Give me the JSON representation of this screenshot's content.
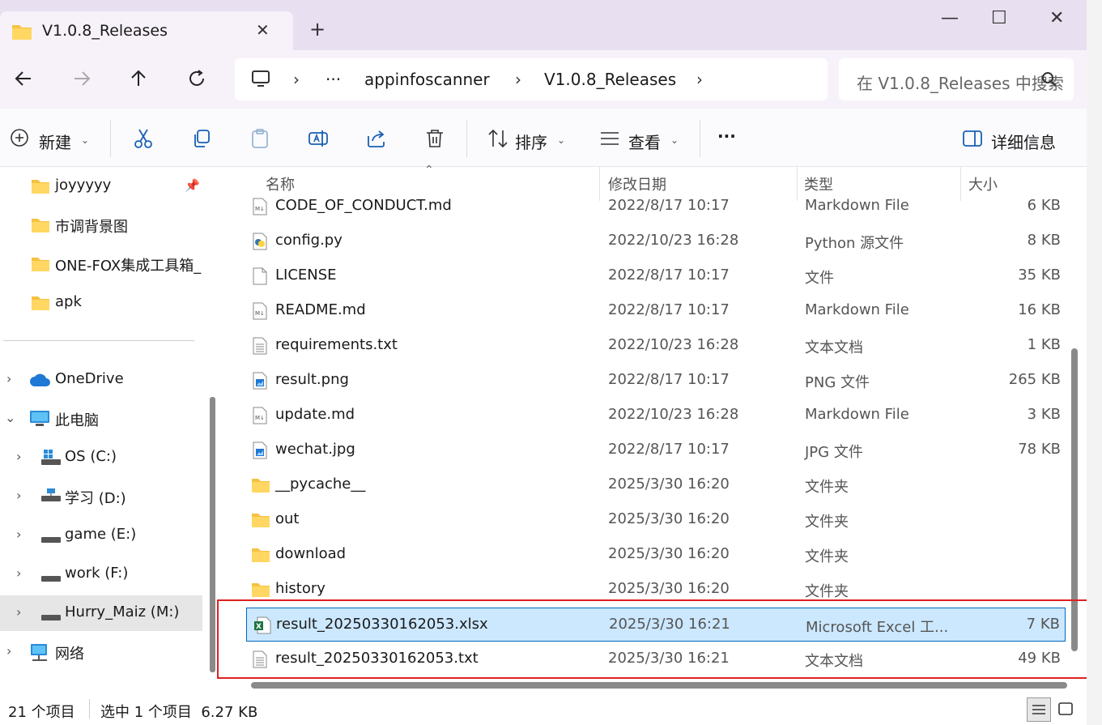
{
  "window": {
    "tab_title": "V1.0.8_Releases",
    "tab_close": "✕",
    "new_tab": "+",
    "minimize": "—",
    "maximize": "☐",
    "close": "✕"
  },
  "nav": {
    "breadcrumbs": [
      "appinfoscanner",
      "V1.0.8_Releases"
    ],
    "more": "···",
    "search_placeholder": "在 V1.0.8_Releases 中搜索"
  },
  "toolbar": {
    "new_label": "新建",
    "sort_label": "排序",
    "view_label": "查看",
    "more": "···",
    "details_label": "详细信息"
  },
  "sidebar": {
    "pinned": [
      {
        "label": "joyyyyy",
        "icon": "folder-icon",
        "pinned": true
      },
      {
        "label": "市调背景图",
        "icon": "folder-icon"
      },
      {
        "label": "ONE-FOX集成工具箱_",
        "icon": "folder-icon"
      },
      {
        "label": "apk",
        "icon": "folder-icon"
      }
    ],
    "tree": [
      {
        "label": "OneDrive",
        "icon": "cloud-icon",
        "expander": "›"
      },
      {
        "label": "此电脑",
        "icon": "computer-icon",
        "expander": "⌄"
      },
      {
        "label": "OS (C:)",
        "icon": "os-drive-icon",
        "expander": "›"
      },
      {
        "label": "学习 (D:)",
        "icon": "network-drive-icon",
        "expander": "›"
      },
      {
        "label": "game (E:)",
        "icon": "drive-icon",
        "expander": "›"
      },
      {
        "label": "work (F:)",
        "icon": "drive-icon",
        "expander": "›"
      },
      {
        "label": "Hurry_Maiz (M:)",
        "icon": "drive-icon",
        "expander": "›",
        "active": true
      },
      {
        "label": "网络",
        "icon": "network-icon",
        "expander": "›"
      }
    ]
  },
  "columns": {
    "name": "名称",
    "date": "修改日期",
    "type": "类型",
    "size": "大小"
  },
  "files": [
    {
      "name": "CODE_OF_CONDUCT.md",
      "date": "2022/8/17 10:17",
      "type": "Markdown File",
      "size": "6 KB",
      "icon": "markdown-icon"
    },
    {
      "name": "config.py",
      "date": "2022/10/23 16:28",
      "type": "Python 源文件",
      "size": "8 KB",
      "icon": "python-icon"
    },
    {
      "name": "LICENSE",
      "date": "2022/8/17 10:17",
      "type": "文件",
      "size": "35 KB",
      "icon": "file-icon"
    },
    {
      "name": "README.md",
      "date": "2022/8/17 10:17",
      "type": "Markdown File",
      "size": "16 KB",
      "icon": "markdown-icon"
    },
    {
      "name": "requirements.txt",
      "date": "2022/10/23 16:28",
      "type": "文本文档",
      "size": "1 KB",
      "icon": "text-file-icon"
    },
    {
      "name": "result.png",
      "date": "2022/8/17 10:17",
      "type": "PNG 文件",
      "size": "265 KB",
      "icon": "image-icon"
    },
    {
      "name": "update.md",
      "date": "2022/10/23 16:28",
      "type": "Markdown File",
      "size": "3 KB",
      "icon": "markdown-icon"
    },
    {
      "name": "wechat.jpg",
      "date": "2022/8/17 10:17",
      "type": "JPG 文件",
      "size": "78 KB",
      "icon": "image-icon"
    },
    {
      "name": "__pycache__",
      "date": "2025/3/30 16:20",
      "type": "文件夹",
      "size": "",
      "icon": "folder-icon"
    },
    {
      "name": "out",
      "date": "2025/3/30 16:20",
      "type": "文件夹",
      "size": "",
      "icon": "folder-icon"
    },
    {
      "name": "download",
      "date": "2025/3/30 16:20",
      "type": "文件夹",
      "size": "",
      "icon": "folder-icon"
    },
    {
      "name": "history",
      "date": "2025/3/30 16:20",
      "type": "文件夹",
      "size": "",
      "icon": "folder-icon"
    },
    {
      "name": "result_20250330162053.xlsx",
      "date": "2025/3/30 16:21",
      "type": "Microsoft Excel 工...",
      "size": "7 KB",
      "icon": "excel-icon",
      "selected": true
    },
    {
      "name": "result_20250330162053.txt",
      "date": "2025/3/30 16:21",
      "type": "文本文档",
      "size": "49 KB",
      "icon": "text-file-icon"
    }
  ],
  "status": {
    "item_count": "21 个项目",
    "selection": "选中 1 个项目  6.27 KB"
  },
  "colors": {
    "accent": "#0067c0",
    "selection_bg": "#cce8ff",
    "highlight_box": "#e02020",
    "titlebar_bg": "#e8dff0"
  }
}
